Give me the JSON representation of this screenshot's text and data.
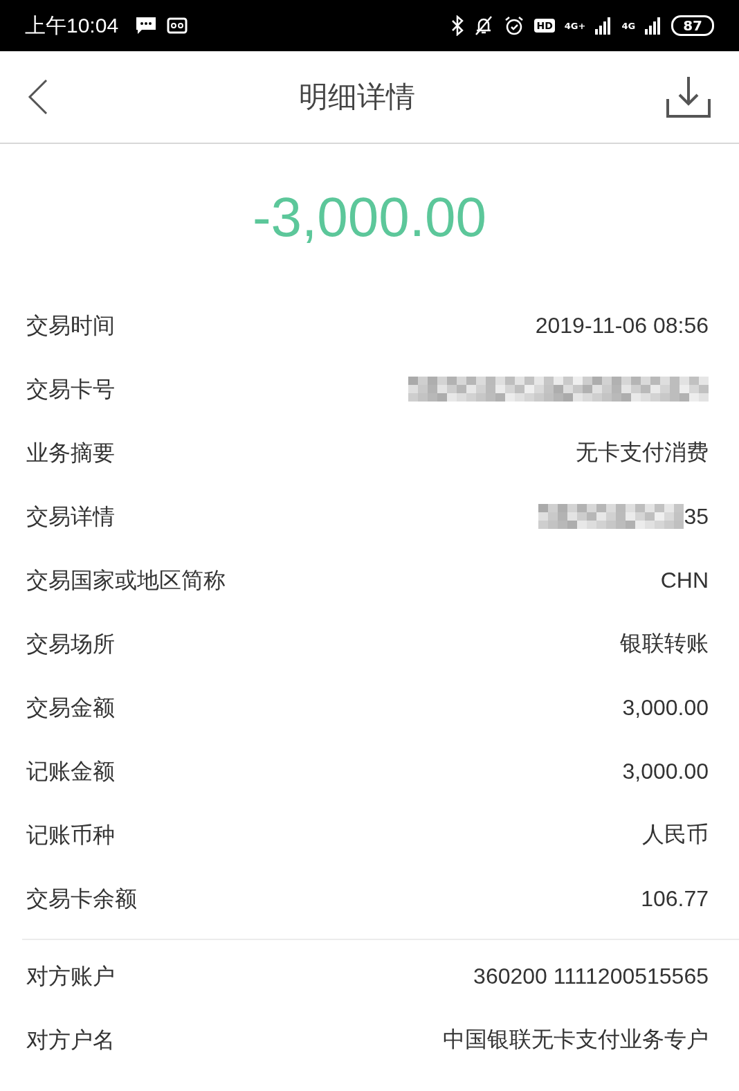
{
  "status_bar": {
    "time": "上午10:04",
    "hd": "HD",
    "network_1": "4G+",
    "network_2": "4G",
    "battery": "87"
  },
  "header": {
    "title": "明细详情"
  },
  "amount": "-3,000.00",
  "details": [
    {
      "label": "交易时间",
      "value": "2019-11-06 08:56",
      "kind": "text"
    },
    {
      "label": "交易卡号",
      "kind": "masked"
    },
    {
      "label": "业务摘要",
      "value": "无卡支付消费",
      "kind": "text"
    },
    {
      "label": "交易详情",
      "value": "35",
      "kind": "masked"
    },
    {
      "label": "交易国家或地区简称",
      "value": "CHN",
      "kind": "text"
    },
    {
      "label": "交易场所",
      "value": "银联转账",
      "kind": "text"
    },
    {
      "label": "交易金额",
      "value": "3,000.00",
      "kind": "text"
    },
    {
      "label": "记账金额",
      "value": "3,000.00",
      "kind": "text"
    },
    {
      "label": "记账币种",
      "value": "人民币",
      "kind": "text"
    },
    {
      "label": "交易卡余额",
      "value": "106.77",
      "kind": "text"
    }
  ],
  "counterparty": [
    {
      "label": "对方账户",
      "value": "360200 1111200515565",
      "kind": "text"
    },
    {
      "label": "对方户名",
      "value": "中国银联无卡支付业务专户",
      "kind": "text"
    }
  ]
}
